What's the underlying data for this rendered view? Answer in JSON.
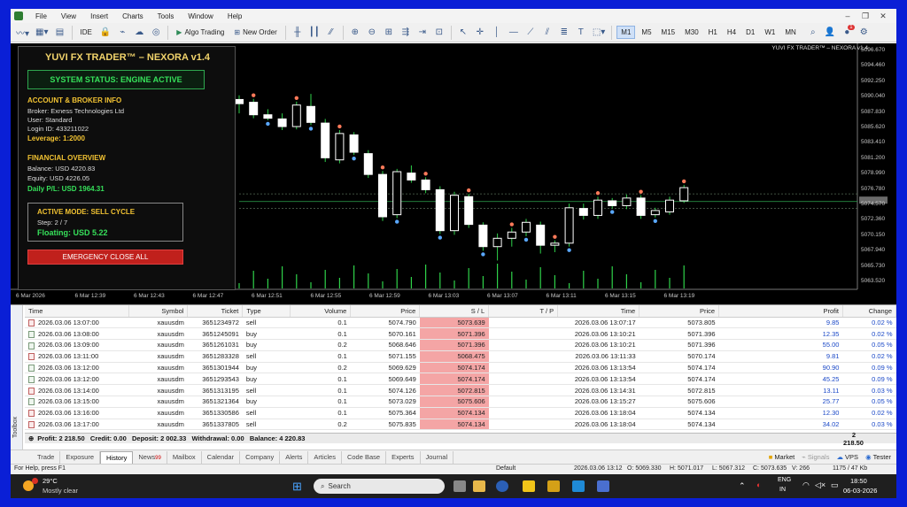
{
  "menu": {
    "items": [
      "File",
      "View",
      "Insert",
      "Charts",
      "Tools",
      "Window",
      "Help"
    ]
  },
  "toolbar": {
    "algo_trading": "Algo Trading",
    "new_order": "New Order",
    "ide": "IDE",
    "timeframes": [
      "M1",
      "M5",
      "M15",
      "M30",
      "H1",
      "H4",
      "D1",
      "W1",
      "MN"
    ],
    "active_timeframe": "M1",
    "notifications": "1"
  },
  "ea": {
    "title": "YUVI FX TRADER™ – NEXORA v1.4",
    "status": "SYSTEM STATUS: ENGINE ACTIVE",
    "account_head": "ACCOUNT & BROKER INFO",
    "broker": "Broker: Exness Technologies Ltd",
    "user": "User: Standard",
    "login": "Login ID: 433211022",
    "leverage": "Leverage: 1:2000",
    "financial_head": "FINANCIAL OVERVIEW",
    "balance": "Balance: USD 4220.83",
    "equity": "Equity: USD 4226.05",
    "daily_pl": "Daily P/L: USD 1964.31",
    "mode": "ACTIVE MODE: SELL CYCLE",
    "step": "Step: 2 / 7",
    "floating": "Floating: USD 5.22",
    "emergency": "EMERGENCY CLOSE ALL"
  },
  "chart": {
    "label": "YUVI FX TRADER™ – NEXORA v1.4",
    "prices": [
      "5096.670",
      "5094.460",
      "5092.250",
      "5090.040",
      "5087.830",
      "5085.620",
      "5083.410",
      "5081.200",
      "5078.990",
      "5076.780",
      "5074.570",
      "5072.360",
      "5070.150",
      "5067.940",
      "5065.730",
      "5063.520"
    ],
    "times": [
      "6 Mar 2026",
      "6 Mar 12:39",
      "6 Mar 12:43",
      "6 Mar 12:47",
      "6 Mar 12:51",
      "6 Mar 12:55",
      "6 Mar 12:59",
      "6 Mar 13:03",
      "6 Mar 13:07",
      "6 Mar 13:11",
      "6 Mar 13:15",
      "6 Mar 13:19"
    ]
  },
  "chart_data": {
    "type": "candlestick",
    "ylim": [
      5063.52,
      5096.67
    ],
    "candles": [
      {
        "o": 5089.6,
        "h": 5090.2,
        "l": 5087.6,
        "c": 5089.0
      },
      {
        "o": 5089.2,
        "h": 5089.7,
        "l": 5086.9,
        "c": 5087.4
      },
      {
        "o": 5087.4,
        "h": 5088.2,
        "l": 5086.6,
        "c": 5086.9
      },
      {
        "o": 5086.8,
        "h": 5087.6,
        "l": 5085.2,
        "c": 5085.7
      },
      {
        "o": 5085.7,
        "h": 5089.3,
        "l": 5085.3,
        "c": 5088.8
      },
      {
        "o": 5088.6,
        "h": 5090.4,
        "l": 5085.9,
        "c": 5086.3
      },
      {
        "o": 5086.2,
        "h": 5086.8,
        "l": 5080.6,
        "c": 5081.2
      },
      {
        "o": 5080.9,
        "h": 5085.2,
        "l": 5080.4,
        "c": 5084.7
      },
      {
        "o": 5084.5,
        "h": 5084.9,
        "l": 5081.6,
        "c": 5082.0
      },
      {
        "o": 5081.8,
        "h": 5082.3,
        "l": 5078.3,
        "c": 5078.8
      },
      {
        "o": 5078.8,
        "h": 5079.3,
        "l": 5072.1,
        "c": 5072.7
      },
      {
        "o": 5073.0,
        "h": 5079.6,
        "l": 5072.5,
        "c": 5079.2
      },
      {
        "o": 5079.0,
        "h": 5080.1,
        "l": 5077.6,
        "c": 5078.0
      },
      {
        "o": 5078.0,
        "h": 5078.4,
        "l": 5076.1,
        "c": 5076.6
      },
      {
        "o": 5076.6,
        "h": 5077.1,
        "l": 5070.2,
        "c": 5070.7
      },
      {
        "o": 5070.7,
        "h": 5076.3,
        "l": 5070.1,
        "c": 5075.8
      },
      {
        "o": 5075.6,
        "h": 5076.0,
        "l": 5071.1,
        "c": 5071.6
      },
      {
        "o": 5071.5,
        "h": 5071.9,
        "l": 5067.8,
        "c": 5068.4
      },
      {
        "o": 5068.4,
        "h": 5070.3,
        "l": 5066.4,
        "c": 5069.6
      },
      {
        "o": 5069.6,
        "h": 5071.1,
        "l": 5068.4,
        "c": 5070.5
      },
      {
        "o": 5070.5,
        "h": 5072.4,
        "l": 5069.9,
        "c": 5071.9
      },
      {
        "o": 5071.5,
        "h": 5072.0,
        "l": 5067.4,
        "c": 5068.6
      },
      {
        "o": 5068.6,
        "h": 5069.3,
        "l": 5067.6,
        "c": 5068.9
      },
      {
        "o": 5068.9,
        "h": 5074.6,
        "l": 5068.4,
        "c": 5074.0
      },
      {
        "o": 5073.9,
        "h": 5074.6,
        "l": 5072.3,
        "c": 5072.9
      },
      {
        "o": 5072.9,
        "h": 5075.6,
        "l": 5072.4,
        "c": 5075.1
      },
      {
        "o": 5075.0,
        "h": 5075.4,
        "l": 5073.9,
        "c": 5074.3
      },
      {
        "o": 5074.3,
        "h": 5075.9,
        "l": 5073.8,
        "c": 5075.4
      },
      {
        "o": 5075.4,
        "h": 5075.8,
        "l": 5072.4,
        "c": 5072.9
      },
      {
        "o": 5073.0,
        "h": 5074.0,
        "l": 5072.6,
        "c": 5073.6
      },
      {
        "o": 5073.4,
        "h": 5075.6,
        "l": 5073.0,
        "c": 5075.1
      },
      {
        "o": 5075.0,
        "h": 5077.3,
        "l": 5074.7,
        "c": 5076.9
      }
    ],
    "levels": [
      5076.0,
      5074.9,
      5073.9
    ]
  },
  "positions": {
    "columns": [
      "Time",
      "Symbol",
      "Ticket",
      "Type",
      "Volume",
      "Price",
      "S / L",
      "T / P",
      "Time",
      "Price",
      "Profit",
      "Change"
    ],
    "rows": [
      [
        "2026.03.06 13:07:00",
        "xauusdm",
        "3651234972",
        "sell",
        "0.1",
        "5074.790",
        "5073.639",
        "",
        "2026.03.06 13:07:17",
        "5073.805",
        "9.85",
        "0.02 %"
      ],
      [
        "2026.03.06 13:08:00",
        "xauusdm",
        "3651245091",
        "buy",
        "0.1",
        "5070.161",
        "5071.396",
        "",
        "2026.03.06 13:10:21",
        "5071.396",
        "12.35",
        "0.02 %"
      ],
      [
        "2026.03.06 13:09:00",
        "xauusdm",
        "3651261031",
        "buy",
        "0.2",
        "5068.646",
        "5071.396",
        "",
        "2026.03.06 13:10:21",
        "5071.396",
        "55.00",
        "0.05 %"
      ],
      [
        "2026.03.06 13:11:00",
        "xauusdm",
        "3651283328",
        "sell",
        "0.1",
        "5071.155",
        "5068.475",
        "",
        "2026.03.06 13:11:33",
        "5070.174",
        "9.81",
        "0.02 %"
      ],
      [
        "2026.03.06 13:12:00",
        "xauusdm",
        "3651301944",
        "buy",
        "0.2",
        "5069.629",
        "5074.174",
        "",
        "2026.03.06 13:13:54",
        "5074.174",
        "90.90",
        "0.09 %"
      ],
      [
        "2026.03.06 13:12:00",
        "xauusdm",
        "3651293543",
        "buy",
        "0.1",
        "5069.649",
        "5074.174",
        "",
        "2026.03.06 13:13:54",
        "5074.174",
        "45.25",
        "0.09 %"
      ],
      [
        "2026.03.06 13:14:00",
        "xauusdm",
        "3651313195",
        "sell",
        "0.1",
        "5074.126",
        "5072.815",
        "",
        "2026.03.06 13:14:31",
        "5072.815",
        "13.11",
        "0.03 %"
      ],
      [
        "2026.03.06 13:15:00",
        "xauusdm",
        "3651321364",
        "buy",
        "0.1",
        "5073.029",
        "5075.606",
        "",
        "2026.03.06 13:15:27",
        "5075.606",
        "25.77",
        "0.05 %"
      ],
      [
        "2026.03.06 13:16:00",
        "xauusdm",
        "3651330586",
        "sell",
        "0.1",
        "5075.364",
        "5074.134",
        "",
        "2026.03.06 13:18:04",
        "5074.134",
        "12.30",
        "0.02 %"
      ],
      [
        "2026.03.06 13:17:00",
        "xauusdm",
        "3651337805",
        "sell",
        "0.2",
        "5075.835",
        "5074.134",
        "",
        "2026.03.06 13:18:04",
        "5074.134",
        "34.02",
        "0.03 %"
      ]
    ],
    "summary": "Profit: 2 218.50   Credit: 0.00   Deposit: 2 002.33   Withdrawal: 0.00   Balance: 4 220.83",
    "total": "2 218.50"
  },
  "toolbox_label": "Toolbox",
  "tabs": {
    "items": [
      "Trade",
      "Exposure",
      "History",
      "News",
      "Mailbox",
      "Calendar",
      "Company",
      "Alerts",
      "Articles",
      "Code Base",
      "Experts",
      "Journal"
    ],
    "news_badge": "99",
    "active": "History",
    "market": "Market",
    "signals": "Signals",
    "vps": "VPS",
    "tester": "Tester"
  },
  "statusbar": {
    "help": "For Help, press F1",
    "profile": "Default",
    "datetime": "2026.03.06 13:12",
    "open": "O: 5069.330",
    "high": "H: 5071.017",
    "low": "L: 5067.312",
    "close": "C: 5073.635",
    "volume": "V: 266",
    "traffic": "1175 / 47 Kb"
  },
  "taskbar": {
    "temp": "29°C",
    "weather": "Mostly clear",
    "search": "Search",
    "lang": "ENG",
    "region": "IN",
    "time": "18:50",
    "date": "06-03-2026"
  },
  "colors": {
    "bull": "#ffffff",
    "bear": "#ffffff",
    "accent": "#f1c232",
    "status_green": "#36e05a",
    "sl_bg": "#f4a5a5",
    "frame": "#0a1fd6"
  }
}
